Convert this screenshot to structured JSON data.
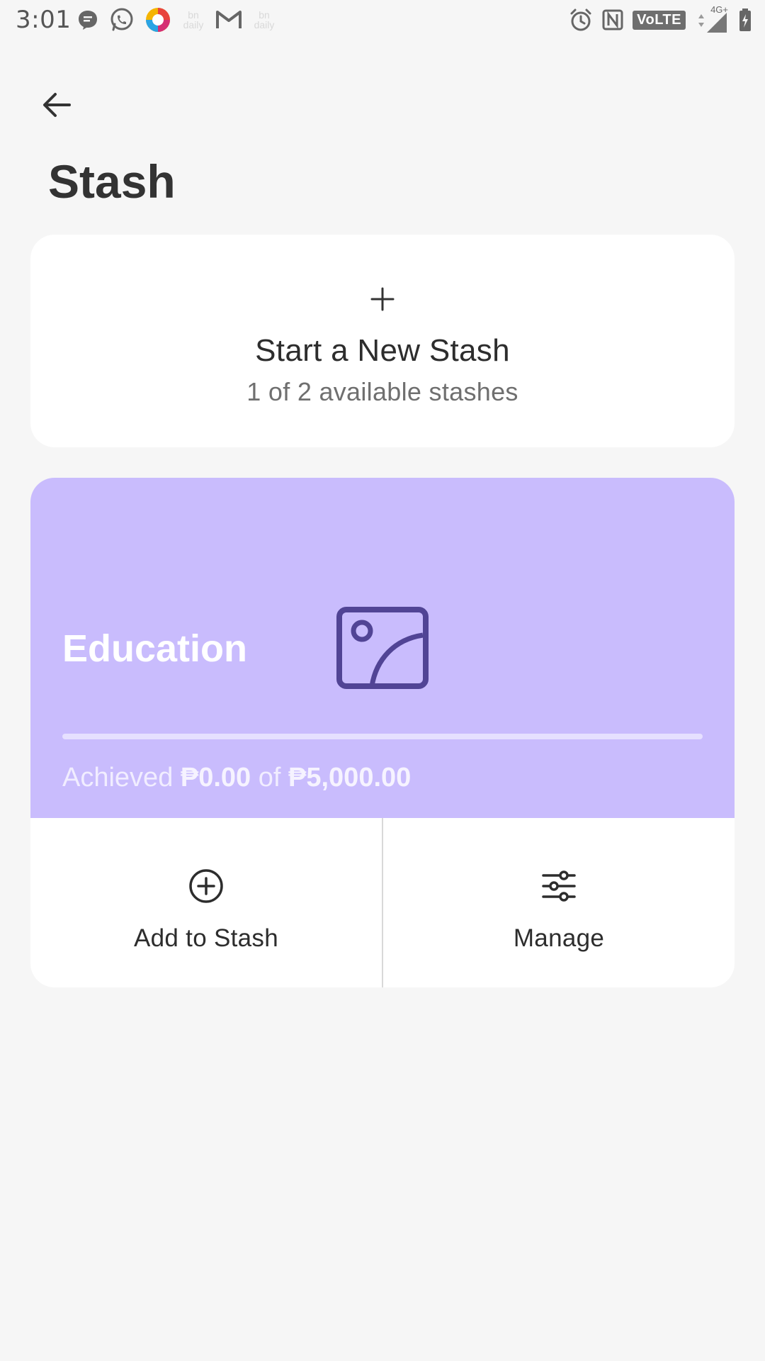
{
  "status_bar": {
    "time": "3:01",
    "network_label": "4G+",
    "volte_label": "VoLTE",
    "left_icons": [
      "message-icon",
      "whatsapp-icon",
      "browser-icon",
      "bn-daily-icon",
      "gmail-icon",
      "bn-daily-icon"
    ],
    "right_icons": [
      "alarm-icon",
      "nfc-icon",
      "volte-icon",
      "signal-icon",
      "battery-charging-icon"
    ],
    "ghost_icon_label": "bn\ndaily"
  },
  "header": {
    "back_icon": "arrow-left-icon",
    "title": "Stash"
  },
  "new_stash": {
    "icon": "plus-icon",
    "title": "Start a New Stash",
    "subtitle": "1 of 2 available stashes"
  },
  "stash": {
    "name": "Education",
    "image_icon": "image-placeholder-icon",
    "accent_color": "#c9bcfd",
    "progress_fraction": 0,
    "achieved_prefix": "Achieved ",
    "achieved_amount": "₱0.00",
    "achieved_of": " of ",
    "target_amount": "₱5,000.00",
    "actions": {
      "add": {
        "icon": "plus-circle-icon",
        "label": "Add to Stash"
      },
      "manage": {
        "icon": "sliders-icon",
        "label": "Manage"
      }
    }
  }
}
